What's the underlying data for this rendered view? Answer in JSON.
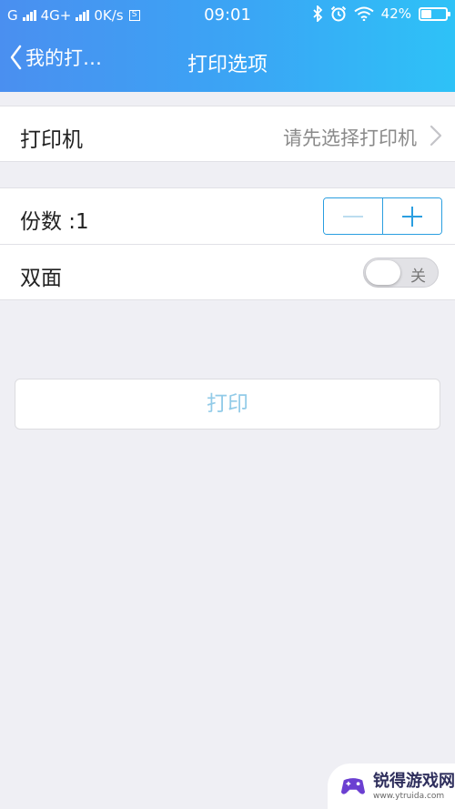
{
  "status_bar": {
    "carrier1": "G",
    "carrier2": "4G+",
    "speed": "0K/s",
    "s_badge": "S",
    "time": "09:01",
    "battery_percent": "42%",
    "battery_level": 0.42
  },
  "nav": {
    "back_label": "我的打…",
    "title": "打印选项"
  },
  "printer": {
    "label": "打印机",
    "value": "请先选择打印机"
  },
  "copies": {
    "label": "份数 :1",
    "minus_icon": "minus-icon",
    "plus_icon": "plus-icon"
  },
  "duplex": {
    "label": "双面",
    "state": "关",
    "on": false
  },
  "print_button": {
    "label": "打印"
  },
  "watermark": {
    "text": "锐得游戏网",
    "sub": "www.ytruida.com"
  },
  "colors": {
    "header_start": "#4a8ff0",
    "header_end": "#2ec2f7",
    "accent": "#2a9ee0",
    "disabled_text": "#92cbe8"
  }
}
